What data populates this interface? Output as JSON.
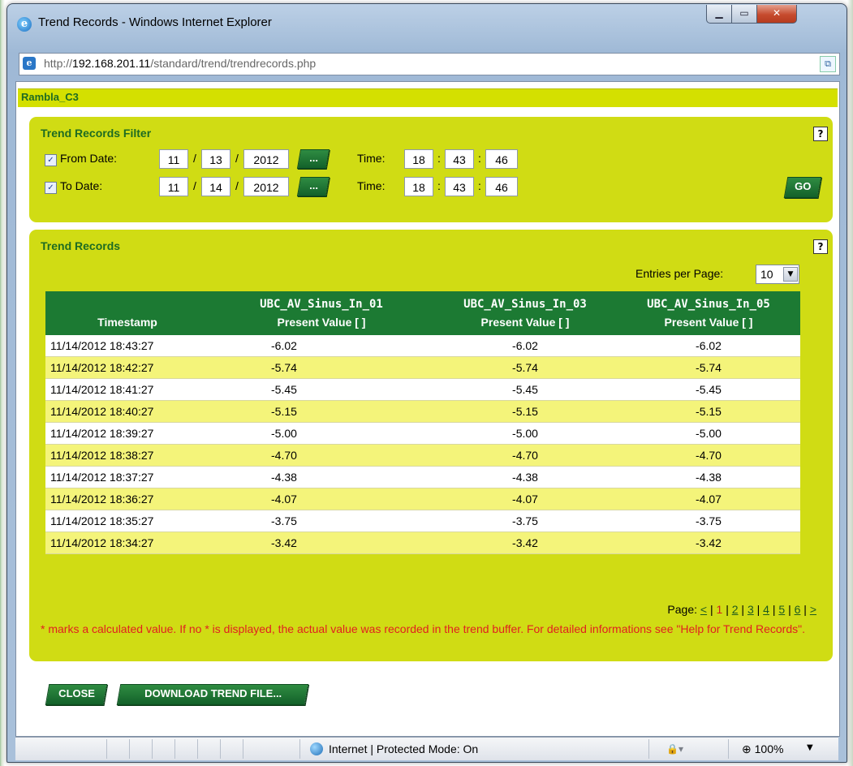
{
  "window": {
    "title": "Trend Records - Windows Internet Explorer",
    "url_prefix": "http://",
    "url_host": "192.168.201.11",
    "url_path": "/standard/trend/trendrecords.php"
  },
  "site": {
    "title": "Rambla_C3"
  },
  "filter": {
    "title": "Trend Records Filter",
    "help": "?",
    "from": {
      "label": "From Date:",
      "checked": true,
      "month": "11",
      "day": "13",
      "year": "2012",
      "time_label": "Time:",
      "hour": "18",
      "minute": "43",
      "second": "46"
    },
    "to": {
      "label": "To Date:",
      "checked": true,
      "month": "11",
      "day": "14",
      "year": "2012",
      "time_label": "Time:",
      "hour": "18",
      "minute": "43",
      "second": "46"
    },
    "picker_label": "...",
    "date_sep": "/",
    "time_sep": ":",
    "go_label": "GO"
  },
  "records": {
    "title": "Trend Records",
    "help": "?",
    "entries_label": "Entries per Page:",
    "entries_value": "10",
    "columns": [
      {
        "line1": "",
        "line2": "Timestamp"
      },
      {
        "line1": "UBC_AV_Sinus_In_01",
        "line2": "Present Value [ ]"
      },
      {
        "line1": "UBC_AV_Sinus_In_03",
        "line2": "Present Value [ ]"
      },
      {
        "line1": "UBC_AV_Sinus_In_05",
        "line2": "Present Value [ ]"
      }
    ],
    "rows": [
      [
        "11/14/2012 18:43:27",
        "-6.02",
        "-6.02",
        "-6.02"
      ],
      [
        "11/14/2012 18:42:27",
        "-5.74",
        "-5.74",
        "-5.74"
      ],
      [
        "11/14/2012 18:41:27",
        "-5.45",
        "-5.45",
        "-5.45"
      ],
      [
        "11/14/2012 18:40:27",
        "-5.15",
        "-5.15",
        "-5.15"
      ],
      [
        "11/14/2012 18:39:27",
        "-5.00",
        "-5.00",
        "-5.00"
      ],
      [
        "11/14/2012 18:38:27",
        "-4.70",
        "-4.70",
        "-4.70"
      ],
      [
        "11/14/2012 18:37:27",
        "-4.38",
        "-4.38",
        "-4.38"
      ],
      [
        "11/14/2012 18:36:27",
        "-4.07",
        "-4.07",
        "-4.07"
      ],
      [
        "11/14/2012 18:35:27",
        "-3.75",
        "-3.75",
        "-3.75"
      ],
      [
        "11/14/2012 18:34:27",
        "-3.42",
        "-3.42",
        "-3.42"
      ]
    ],
    "pager": {
      "label": "Page:",
      "prev": "<",
      "current": "1",
      "pages": [
        "2",
        "3",
        "4",
        "5",
        "6"
      ],
      "next": ">",
      "sep": "|"
    },
    "note": "* marks a calculated value. If no * is displayed, the actual value was recorded in the trend buffer. For detailed informations see \"Help for Trend Records\"."
  },
  "buttons": {
    "close": "CLOSE",
    "download": "DOWNLOAD TREND FILE..."
  },
  "status": {
    "zone": "Internet | Protected Mode: On",
    "zoom": "100%"
  },
  "colors": {
    "panel": "#d0dc14",
    "header_bar": "#d4e000",
    "table_header": "#1c7a33",
    "row_alt": "#f4f47a",
    "title_green": "#1e6b22",
    "note_red": "#e12020"
  },
  "icons": [
    "ie-logo-icon",
    "minimize-icon",
    "maximize-icon",
    "close-icon",
    "page-icon",
    "compatibility-view-icon",
    "checkbox-checked-icon",
    "help-icon",
    "dropdown-arrow-icon",
    "globe-icon",
    "security-icon",
    "zoom-icon"
  ]
}
